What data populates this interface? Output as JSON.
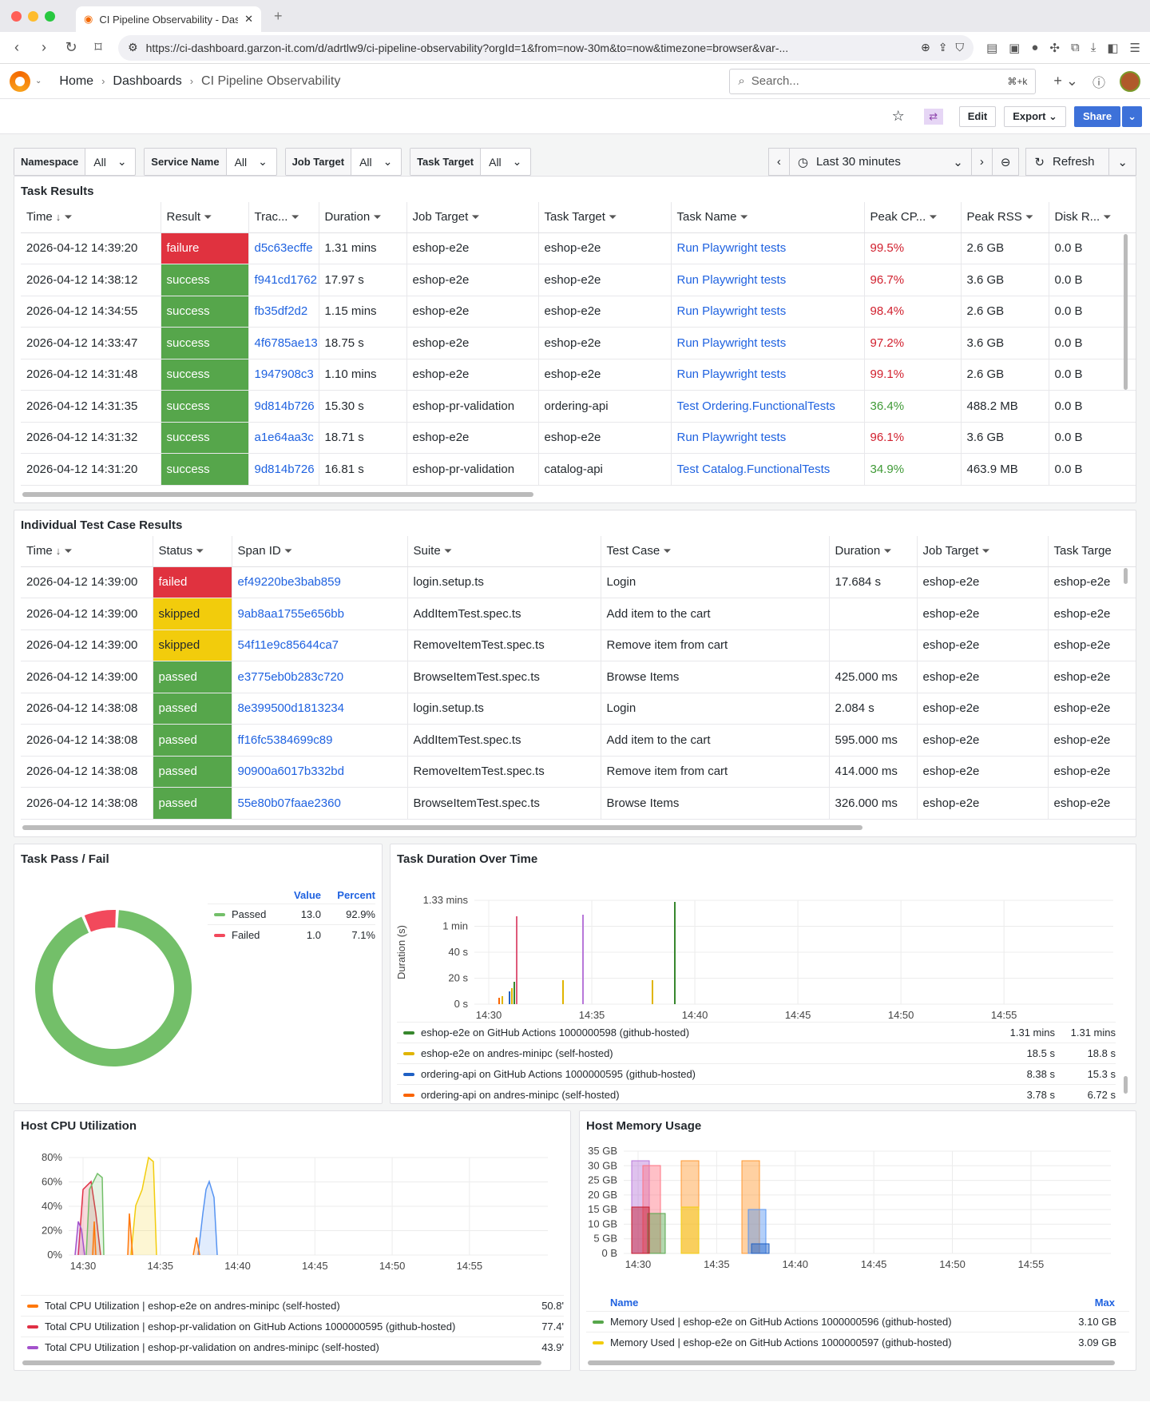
{
  "browser": {
    "tab_title": "CI Pipeline Observability - Das",
    "url": "https://ci-dashboard.garzon-it.com/d/adrtlw9/ci-pipeline-observability?orgId=1&from=now-30m&to=now&timezone=browser&var-..."
  },
  "header": {
    "crumbs": [
      "Home",
      "Dashboards",
      "CI Pipeline Observability"
    ],
    "search_placeholder": "Search...",
    "search_kbd": "⌘+k"
  },
  "toolbar": {
    "edit": "Edit",
    "export": "Export",
    "share": "Share"
  },
  "variables": [
    {
      "label": "Namespace",
      "value": "All"
    },
    {
      "label": "Service Name",
      "value": "All"
    },
    {
      "label": "Job Target",
      "value": "All"
    },
    {
      "label": "Task Target",
      "value": "All"
    }
  ],
  "time": {
    "range": "Last 30 minutes",
    "refresh": "Refresh"
  },
  "task_results": {
    "title": "Task Results",
    "columns": [
      "Time",
      "Result",
      "Trac...",
      "Duration",
      "Job Target",
      "Task Target",
      "Task Name",
      "Peak CP...",
      "Peak RSS",
      "Disk R..."
    ],
    "rows": [
      [
        "2026-04-12 14:39:20",
        "failure",
        "d5c63ecffe",
        "1.31 mins",
        "eshop-e2e",
        "eshop-e2e",
        "Run Playwright tests",
        "99.5%",
        "2.6 GB",
        "0.0 B"
      ],
      [
        "2026-04-12 14:38:12",
        "success",
        "f941cd1762",
        "17.97 s",
        "eshop-e2e",
        "eshop-e2e",
        "Run Playwright tests",
        "96.7%",
        "3.6 GB",
        "0.0 B"
      ],
      [
        "2026-04-12 14:34:55",
        "success",
        "fb35df2d2",
        "1.15 mins",
        "eshop-e2e",
        "eshop-e2e",
        "Run Playwright tests",
        "98.4%",
        "2.6 GB",
        "0.0 B"
      ],
      [
        "2026-04-12 14:33:47",
        "success",
        "4f6785ae13",
        "18.75 s",
        "eshop-e2e",
        "eshop-e2e",
        "Run Playwright tests",
        "97.2%",
        "3.6 GB",
        "0.0 B"
      ],
      [
        "2026-04-12 14:31:48",
        "success",
        "1947908c3",
        "1.10 mins",
        "eshop-e2e",
        "eshop-e2e",
        "Run Playwright tests",
        "99.1%",
        "2.6 GB",
        "0.0 B"
      ],
      [
        "2026-04-12 14:31:35",
        "success",
        "9d814b726",
        "15.30 s",
        "eshop-pr-validation",
        "ordering-api",
        "Test Ordering.FunctionalTests",
        "36.4%",
        "488.2 MB",
        "0.0 B"
      ],
      [
        "2026-04-12 14:31:32",
        "success",
        "a1e64aa3c",
        "18.71 s",
        "eshop-e2e",
        "eshop-e2e",
        "Run Playwright tests",
        "96.1%",
        "3.6 GB",
        "0.0 B"
      ],
      [
        "2026-04-12 14:31:20",
        "success",
        "9d814b726",
        "16.81 s",
        "eshop-pr-validation",
        "catalog-api",
        "Test Catalog.FunctionalTests",
        "34.9%",
        "463.9 MB",
        "0.0 B"
      ]
    ]
  },
  "test_results": {
    "title": "Individual Test Case Results",
    "columns": [
      "Time",
      "Status",
      "Span ID",
      "Suite",
      "Test Case",
      "Duration",
      "Job Target",
      "Task Targe"
    ],
    "rows": [
      [
        "2026-04-12 14:39:00",
        "failed",
        "ef49220be3bab859",
        "login.setup.ts",
        "Login",
        "17.684 s",
        "eshop-e2e",
        "eshop-e2e"
      ],
      [
        "2026-04-12 14:39:00",
        "skipped",
        "9ab8aa1755e656bb",
        "AddItemTest.spec.ts",
        "Add item to the cart",
        "",
        "eshop-e2e",
        "eshop-e2e"
      ],
      [
        "2026-04-12 14:39:00",
        "skipped",
        "54f11e9c85644ca7",
        "RemoveItemTest.spec.ts",
        "Remove item from cart",
        "",
        "eshop-e2e",
        "eshop-e2e"
      ],
      [
        "2026-04-12 14:39:00",
        "passed",
        "e3775eb0b283c720",
        "BrowseItemTest.spec.ts",
        "Browse Items",
        "425.000 ms",
        "eshop-e2e",
        "eshop-e2e"
      ],
      [
        "2026-04-12 14:38:08",
        "passed",
        "8e399500d1813234",
        "login.setup.ts",
        "Login",
        "2.084 s",
        "eshop-e2e",
        "eshop-e2e"
      ],
      [
        "2026-04-12 14:38:08",
        "passed",
        "ff16fc5384699c89",
        "AddItemTest.spec.ts",
        "Add item to the cart",
        "595.000 ms",
        "eshop-e2e",
        "eshop-e2e"
      ],
      [
        "2026-04-12 14:38:08",
        "passed",
        "90900a6017b332bd",
        "RemoveItemTest.spec.ts",
        "Remove item from cart",
        "414.000 ms",
        "eshop-e2e",
        "eshop-e2e"
      ],
      [
        "2026-04-12 14:38:08",
        "passed",
        "55e80b07faae2360",
        "BrowseItemTest.spec.ts",
        "Browse Items",
        "326.000 ms",
        "eshop-e2e",
        "eshop-e2e"
      ]
    ]
  },
  "pass_fail": {
    "title": "Task Pass / Fail",
    "col_value": "Value",
    "col_percent": "Percent",
    "chart_data": {
      "type": "pie",
      "categories": [
        "Passed",
        "Failed"
      ],
      "values": [
        13.0,
        1.0
      ],
      "percent": [
        "92.9%",
        "7.1%"
      ],
      "colors": [
        "#73bf69",
        "#f2495c"
      ]
    }
  },
  "duration": {
    "title": "Task Duration Over Time",
    "ylabel": "Duration (s)",
    "chart_data": {
      "type": "bar",
      "x_ticks": [
        "14:30",
        "14:35",
        "14:40",
        "14:45",
        "14:50",
        "14:55"
      ],
      "y_ticks": [
        "0 s",
        "20 s",
        "40 s",
        "1 min",
        "1.33 mins"
      ],
      "ylim": [
        0,
        80
      ]
    },
    "legend": [
      {
        "name": "eshop-e2e on GitHub Actions 1000000598 (github-hosted)",
        "mean": "1.31 mins",
        "max": "1.31 mins",
        "color": "#37872d"
      },
      {
        "name": "eshop-e2e on andres-minipc (self-hosted)",
        "mean": "18.5 s",
        "max": "18.8 s",
        "color": "#e0b400"
      },
      {
        "name": "ordering-api on GitHub Actions 1000000595 (github-hosted)",
        "mean": "8.38 s",
        "max": "15.3 s",
        "color": "#1f60c4"
      },
      {
        "name": "ordering-api on andres-minipc (self-hosted)",
        "mean": "3.78 s",
        "max": "6.72 s",
        "color": "#fa6400"
      }
    ]
  },
  "cpu": {
    "title": "Host CPU Utilization",
    "chart_data": {
      "type": "area",
      "x_ticks": [
        "14:30",
        "14:35",
        "14:40",
        "14:45",
        "14:50",
        "14:55"
      ],
      "y_ticks": [
        "0%",
        "20%",
        "40%",
        "60%",
        "80%"
      ],
      "ylim": [
        0,
        90
      ]
    },
    "legend": [
      {
        "name": "Total CPU Utilization | eshop-e2e on andres-minipc (self-hosted)",
        "value": "50.8'",
        "color": "#ff780a"
      },
      {
        "name": "Total CPU Utilization | eshop-pr-validation on GitHub Actions 1000000595 (github-hosted)",
        "value": "77.4'",
        "color": "#e02f44"
      },
      {
        "name": "Total CPU Utilization | eshop-pr-validation on andres-minipc (self-hosted)",
        "value": "43.9'",
        "color": "#a352cc"
      }
    ]
  },
  "mem": {
    "title": "Host Memory Usage",
    "col_name": "Name",
    "col_max": "Max",
    "chart_data": {
      "type": "area",
      "x_ticks": [
        "14:30",
        "14:35",
        "14:40",
        "14:45",
        "14:50",
        "14:55"
      ],
      "y_ticks": [
        "0 B",
        "5 GB",
        "10 GB",
        "15 GB",
        "20 GB",
        "25 GB",
        "30 GB",
        "35 GB"
      ],
      "ylim": [
        0,
        35
      ]
    },
    "legend": [
      {
        "name": "Memory Used | eshop-e2e on GitHub Actions 1000000596 (github-hosted)",
        "max": "3.10 GB",
        "color": "#56a64b"
      },
      {
        "name": "Memory Used | eshop-e2e on GitHub Actions 1000000597 (github-hosted)",
        "max": "3.09 GB",
        "color": "#f2cc0c"
      }
    ]
  }
}
